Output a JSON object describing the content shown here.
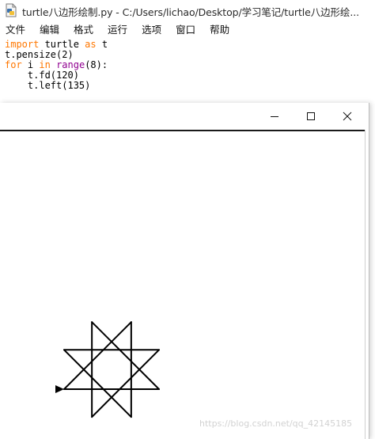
{
  "editor": {
    "title": "turtle八边形绘制.py - C:/Users/lichao/Desktop/学习笔记/turtle八边形绘...",
    "menu": [
      "文件",
      "编辑",
      "格式",
      "运行",
      "选项",
      "窗口",
      "帮助"
    ],
    "code": [
      [
        {
          "t": "import",
          "c": "kw"
        },
        {
          "t": " turtle ",
          "c": ""
        },
        {
          "t": "as",
          "c": "kw"
        },
        {
          "t": " t",
          "c": ""
        }
      ],
      [
        {
          "t": "t.pensize(2)",
          "c": ""
        }
      ],
      [
        {
          "t": "for",
          "c": "kw"
        },
        {
          "t": " i ",
          "c": ""
        },
        {
          "t": "in",
          "c": "kw"
        },
        {
          "t": " ",
          "c": ""
        },
        {
          "t": "range",
          "c": "bi"
        },
        {
          "t": "(8):",
          "c": ""
        }
      ],
      [
        {
          "t": "    t.fd(120)",
          "c": ""
        }
      ],
      [
        {
          "t": "    t.left(135)",
          "c": ""
        }
      ]
    ]
  },
  "turtle_window": {
    "title": "",
    "buttons": [
      "minimize",
      "maximize",
      "close"
    ],
    "drawing": {
      "pensize": 2,
      "steps": 8,
      "forward": 120,
      "turn_left_degrees": 135
    },
    "watermark": "https://blog.csdn.net/qq_42145185"
  },
  "colors": {
    "keyword": "#ff7700",
    "builtin": "#900090",
    "text": "#000000",
    "pen": "#000000"
  }
}
